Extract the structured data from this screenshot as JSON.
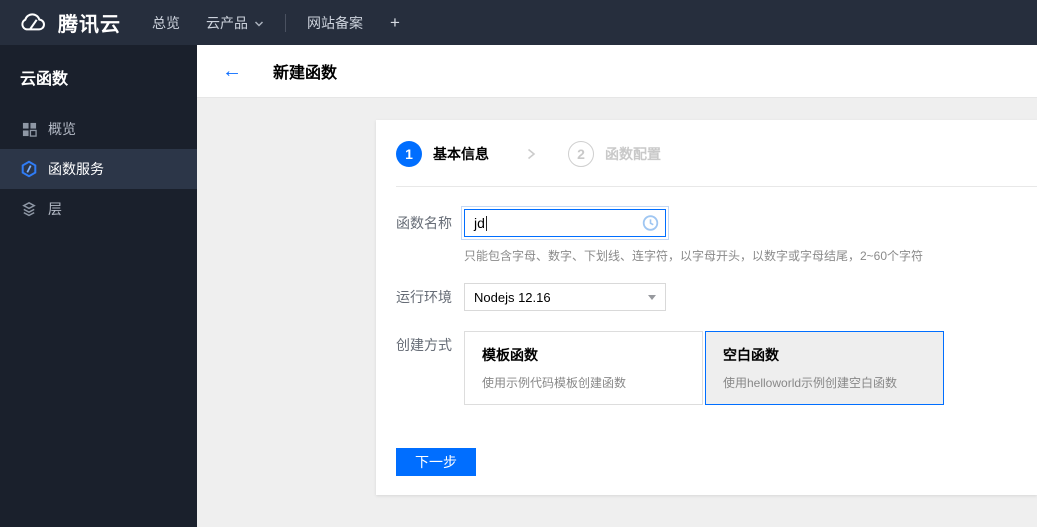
{
  "topbar": {
    "brand": "腾讯云",
    "nav_overview": "总览",
    "nav_products": "云产品",
    "nav_beian": "网站备案",
    "nav_add": "+"
  },
  "sidebar": {
    "title": "云函数",
    "items": [
      {
        "label": "概览",
        "icon": "grid-icon",
        "selected": false
      },
      {
        "label": "函数服务",
        "icon": "function-hexagon-icon",
        "selected": true
      },
      {
        "label": "层",
        "icon": "layers-icon",
        "selected": false
      }
    ]
  },
  "header": {
    "back_arrow": "←",
    "title": "新建函数"
  },
  "steps": [
    {
      "num": "1",
      "label": "基本信息",
      "active": true
    },
    {
      "num": "2",
      "label": "函数配置",
      "active": false
    }
  ],
  "form": {
    "name_label": "函数名称",
    "name_value": "jd",
    "name_status_icon": "clock-pending-icon",
    "name_hint": "只能包含字母、数字、下划线、连字符，以字母开头，以数字或字母结尾，2~60个字符",
    "runtime_label": "运行环境",
    "runtime_value": "Nodejs 12.16",
    "method_label": "创建方式",
    "methods": [
      {
        "title": "模板函数",
        "desc": "使用示例代码模板创建函数",
        "selected": false
      },
      {
        "title": "空白函数",
        "desc": "使用helloworld示例创建空白函数",
        "selected": true
      }
    ],
    "next_label": "下一步"
  },
  "colors": {
    "brand_blue": "#006eff",
    "topbar_bg": "#262e3d",
    "sidebar_bg": "#1a202c",
    "sidebar_selected_bg": "#2c3648",
    "content_bg": "#efefef",
    "selected_card_bg": "#eeeeee"
  }
}
